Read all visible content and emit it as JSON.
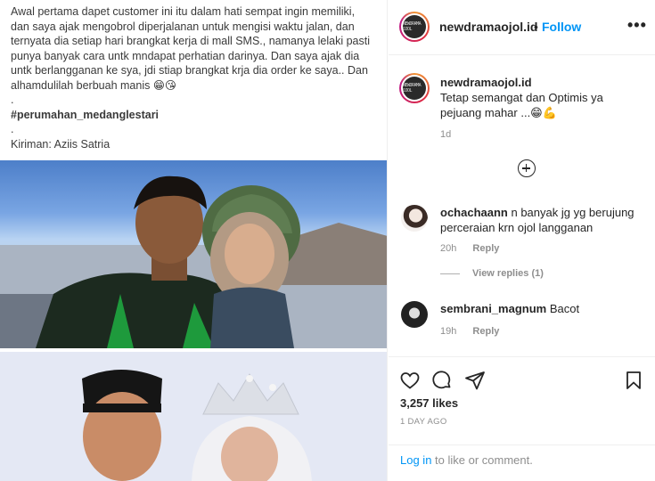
{
  "post": {
    "caption_lines": [
      "Awal pertama dapet customer ini itu dalam hati sempat ingin memiliki,",
      "dan saya ajak mengobrol diperjalanan untuk mengisi waktu jalan, dan",
      "ternyata dia setiap hari brangkat kerja di mall SMS., namanya lelaki pasti",
      "punya banyak cara untk mndapat perhatian darinya. Dan saya ajak dia",
      "untk berlangganan ke sya, jdi stiap brangkat krja dia order ke saya.. Dan",
      "alhamdulilah berbuah manis 😁😘",
      ".",
      "#perumahan_medanglestari",
      ".",
      "Kiriman: Aziis Satria"
    ]
  },
  "header": {
    "username": "newdramaojol.id",
    "separator": "•",
    "follow_label": "Follow",
    "more_label": "•••",
    "avatar_text": "NEWDRAMA OJOL"
  },
  "owner_caption": {
    "username": "newdramaojol.id",
    "text": "Tetap semangat dan Optimis ya pejuang mahar ...😁💪",
    "time": "1d"
  },
  "comments": [
    {
      "username": "ochachaann",
      "text": "n banyak jg yg berujung perceraian krn ojol langganan",
      "time": "20h",
      "reply_label": "Reply",
      "view_replies": "View replies (1)"
    },
    {
      "username": "sembrani_magnum",
      "text": "Bacot",
      "time": "19h",
      "reply_label": "Reply"
    }
  ],
  "actions": {
    "likes": "3,257 likes",
    "date": "1 DAY AGO",
    "login_link": "Log in",
    "login_rest": " to like or comment."
  },
  "icons": [
    "heart-icon",
    "comment-icon",
    "share-icon",
    "bookmark-icon",
    "plus-circle-icon",
    "more-icon"
  ],
  "colors": {
    "accent": "#0095f6",
    "meta": "#8e8e8e",
    "text": "#262626"
  }
}
